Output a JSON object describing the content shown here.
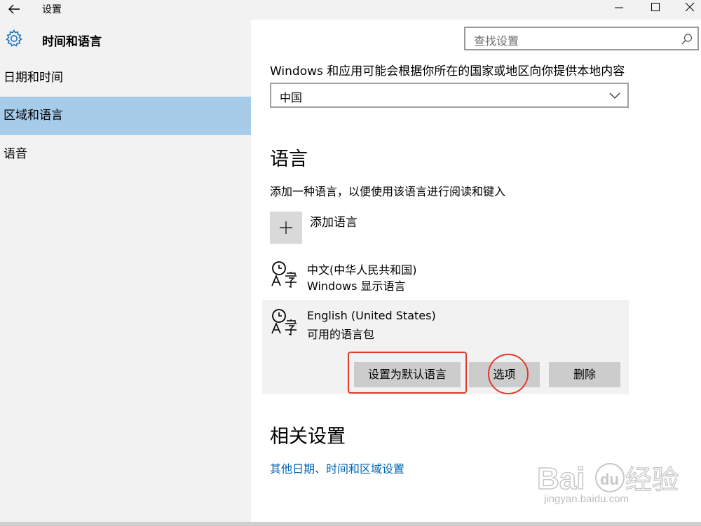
{
  "window": {
    "title": "设置"
  },
  "header": {
    "title": "时间和语言"
  },
  "search": {
    "placeholder": "查找设置"
  },
  "sidebar": {
    "items": [
      {
        "label": "日期和时间",
        "selected": false
      },
      {
        "label": "区域和语言",
        "selected": true
      },
      {
        "label": "语音",
        "selected": false
      }
    ]
  },
  "region": {
    "description": "Windows 和应用可能会根据你所在的国家或地区向你提供本地内容",
    "country_value": "中国"
  },
  "language": {
    "heading": "语言",
    "description": "添加一种语言，以便使用该语言进行阅读和键入",
    "add_label": "添加语言",
    "items": [
      {
        "name": "中文(中华人民共和国)",
        "subtitle": "Windows 显示语言"
      },
      {
        "name": "English (United States)",
        "subtitle": "可用的语言包"
      }
    ],
    "actions": {
      "set_default": "设置为默认语言",
      "options": "选项",
      "remove": "删除"
    }
  },
  "related": {
    "heading": "相关设置",
    "link": "其他日期、时间和区域设置"
  },
  "watermark": {
    "text": "jingyan.baidu.com"
  },
  "colors": {
    "selected_nav": "#a6ccea",
    "link": "#0063b1",
    "highlight": "#e03a2a",
    "panel_bg": "#f2f2f2"
  }
}
